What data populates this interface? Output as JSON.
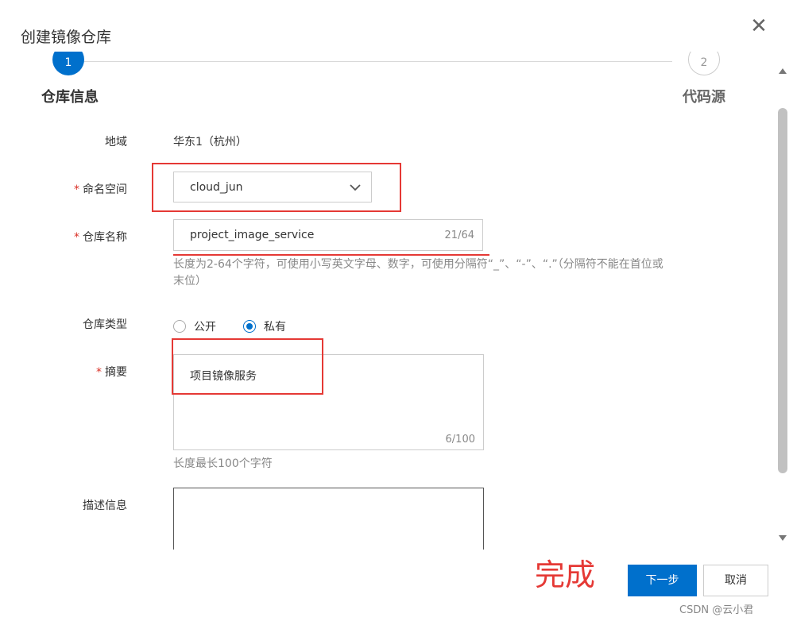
{
  "dialog": {
    "title": "创建镜像仓库",
    "close_icon": "close-icon"
  },
  "steps": [
    {
      "number": "1",
      "label": "仓库信息",
      "state": "active"
    },
    {
      "number": "2",
      "label": "代码源",
      "state": "pending"
    }
  ],
  "form": {
    "region": {
      "label": "地域",
      "value": "华东1（杭州）"
    },
    "namespace": {
      "required_mark": "*",
      "label": "命名空间",
      "value": "cloud_jun",
      "icon": "chevron-down-icon"
    },
    "repo_name": {
      "required_mark": "*",
      "label": "仓库名称",
      "value": "project_image_service",
      "counter": "21/64",
      "help_line1": "长度为2-64个字符，可使用小写英文字母、数字，可使用分隔符“_”、“-”、“.”（分隔符不能在首位或",
      "help_line2": "末位）"
    },
    "repo_type": {
      "label": "仓库类型",
      "options": [
        {
          "label": "公开",
          "checked": false
        },
        {
          "label": "私有",
          "checked": true
        }
      ]
    },
    "summary": {
      "required_mark": "*",
      "label": "摘要",
      "value": "项目镜像服务",
      "counter": "6/100",
      "help": "长度最长100个字符"
    },
    "description": {
      "label": "描述信息",
      "value": ""
    }
  },
  "annotation": {
    "text": "完成",
    "color": "#e53935"
  },
  "footer": {
    "next_label": "下一步",
    "cancel_label": "取消"
  },
  "watermark": "CSDN @云小君",
  "colors": {
    "primary": "#0070cc",
    "required": "#d93026"
  }
}
